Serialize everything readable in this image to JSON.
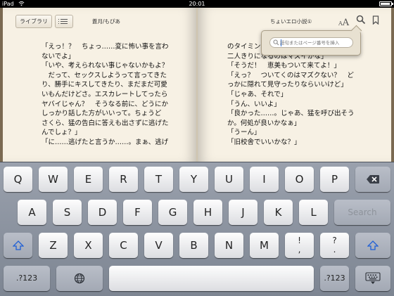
{
  "status_bar": {
    "device": "iPad",
    "time": "20:01"
  },
  "toolbar": {
    "library_button": "ライブラリ",
    "left_title": "蒼月/もぴあ",
    "right_title": "ちょいエロ小説①",
    "font_size_small": "A",
    "font_size_large": "A"
  },
  "search": {
    "placeholder": "語句またはページ番号を挿入"
  },
  "pages": {
    "left_text": "「えっ！？　ちょっ……変に怖い事を言わ\nないでよ」\n「いや、考えられない事じゃないかもよ？\n　だって、セックスしようって言ってきた\nり、勝手にキスしてきたり、まだまだ可愛\nいもんだけどさ。エスカレートしてったら\nヤバイじゃん？　そうなる前に、どうにか\nしっかり話した方がいいって。ちょうど\nさくら、猛の告白に答えも出さずに逃げた\nんでしょ？」\n「に……逃げたと言うか……。まぁ、逃げ",
    "right_text": "のタイミン\n二人きりになるのはマズイかな」\n「そうだ！　恵美もついて来てよ！」\n「えっ？　ついてくのはマズクない？　ど\nっかに隠れて見守ったりならいいけど」\n「じゃあ、それで」\n「うん、いいよ」\n「良かった……。じゃあ、猛を呼び出そう\nか。何処が良いかなぁ」\n「うーん」\n「旧校舎でいいかな？」"
  },
  "keyboard": {
    "row1": [
      "Q",
      "W",
      "E",
      "R",
      "T",
      "Y",
      "U",
      "I",
      "O",
      "P"
    ],
    "row2": [
      "A",
      "S",
      "D",
      "F",
      "G",
      "H",
      "J",
      "K",
      "L"
    ],
    "search_key": "Search",
    "row3": [
      "Z",
      "X",
      "C",
      "V",
      "B",
      "N",
      "M"
    ],
    "row3_punct": [
      [
        "!",
        ","
      ],
      [
        "?",
        "."
      ]
    ],
    "numbers_key": ".?123",
    "icons": {
      "shift": "shift-arrow-icon",
      "delete": "delete-backspace-icon",
      "globe": "globe-icon",
      "dismiss": "keyboard-dismiss-icon"
    }
  }
}
